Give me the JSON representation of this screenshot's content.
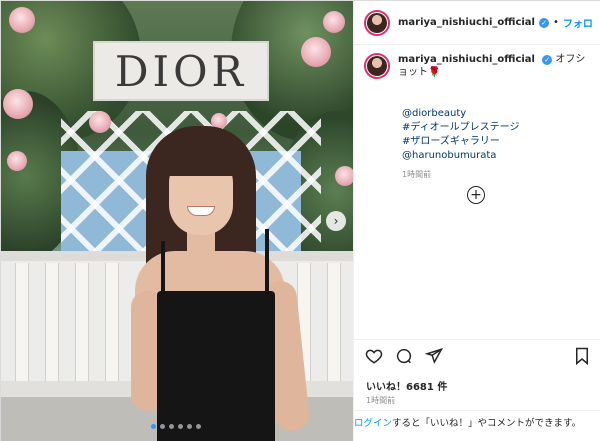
{
  "photo": {
    "sign_text": "DIOR",
    "carousel_dots": 6,
    "active_dot": 0,
    "next_icon": "chevron-right-icon"
  },
  "header": {
    "username": "mariya_nishiuchi_official",
    "separator": "•",
    "follow_label": "フォロ"
  },
  "caption": {
    "username": "mariya_nishiuchi_official",
    "text": "オフショット🌹",
    "lines": [
      "@diorbeauty",
      "#ディオールプレステージ",
      "#ザローズギャラリー",
      "@harunobumurata"
    ],
    "time": "1時間前"
  },
  "actions": {
    "icons": [
      "heart-icon",
      "comment-icon",
      "share-icon",
      "bookmark-icon"
    ],
    "likes": "いいね！6681 件",
    "time": "1時間前",
    "login_link": "ログイン",
    "login_text": "すると「いいね！」やコメントができます。"
  },
  "colors": {
    "accent": "#0095f6",
    "verified": "#3897f0",
    "text": "#262626",
    "muted": "#8e8e8e"
  }
}
